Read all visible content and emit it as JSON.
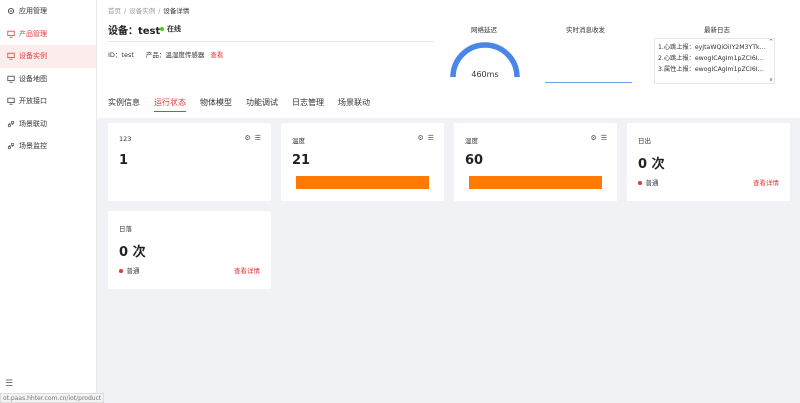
{
  "sidebar": {
    "items": [
      {
        "label": "应用管理",
        "icon": "gear-icon"
      },
      {
        "label": "产品管理",
        "icon": "monitor-icon"
      },
      {
        "label": "设备实例",
        "icon": "monitor-icon"
      },
      {
        "label": "设备地图",
        "icon": "monitor-icon"
      },
      {
        "label": "开放接口",
        "icon": "monitor-icon"
      },
      {
        "label": "场景联动",
        "icon": "link-icon"
      },
      {
        "label": "场景监控",
        "icon": "link-icon"
      }
    ],
    "bottom_icon": "menu-icon"
  },
  "status_url": "ot.paas.hhter.com.cn/iot/product",
  "breadcrumb": {
    "home": "首页",
    "instances": "设备实例",
    "detail": "设备详情"
  },
  "device": {
    "title": "设备：test",
    "status": "在线",
    "id_text": "ID：test",
    "product_text": "产品：温湿度传感器",
    "view_link": "查看"
  },
  "network": {
    "label": "网络延迟",
    "value": "460ms"
  },
  "messages": {
    "label": "实时消息收发"
  },
  "logs": {
    "label": "最新日志",
    "items": [
      "1.心跳上报：eyJtaWQiOiIY2M3YTk…",
      "2.心跳上报：ewogICAgIm1pZCI6ICJ…",
      "3.属性上报：ewogICAgIm1pZCI6ICJ…"
    ]
  },
  "tabs": [
    "实例信息",
    "运行状态",
    "物体模型",
    "功能调试",
    "日志管理",
    "场景联动"
  ],
  "cards": {
    "c1": {
      "name": "123",
      "value": "1"
    },
    "c2": {
      "name": "温度",
      "value": "21",
      "bar_fraction": 1.0
    },
    "c3": {
      "name": "湿度",
      "value": "60",
      "bar_fraction": 1.0
    },
    "c4": {
      "name": "日出",
      "value": "0 次",
      "level": "普通",
      "detail": "查看详情"
    },
    "c5": {
      "name": "日落",
      "value": "0 次",
      "level": "普通",
      "detail": "查看详情"
    }
  },
  "colors": {
    "accent": "#e4393c",
    "bar": "#ff7a00",
    "online": "#52c41a",
    "gauge": "#4a86e8"
  }
}
